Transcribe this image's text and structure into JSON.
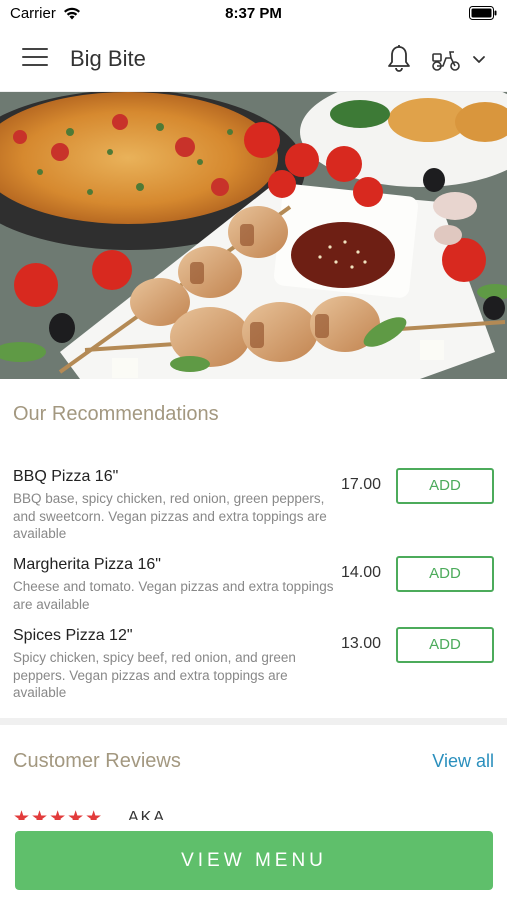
{
  "status_bar": {
    "carrier": "Carrier",
    "time": "8:37 PM"
  },
  "header": {
    "title": "Big Bite",
    "icons": [
      "menu-icon",
      "bell-icon",
      "scooter-icon",
      "chevron-down-icon"
    ]
  },
  "hero": {
    "image_description_icon": "food-photo"
  },
  "recommendations": {
    "title": "Our Recommendations",
    "items": [
      {
        "name": "BBQ Pizza 16\"",
        "description": "BBQ base, spicy chicken, red onion, green peppers, and sweetcorn. Vegan pizzas and extra toppings are available",
        "price": "17.00",
        "add_label": "ADD"
      },
      {
        "name": "Margherita Pizza 16\"",
        "description": "Cheese and tomato. Vegan pizzas and extra toppings are available",
        "price": "14.00",
        "add_label": "ADD"
      },
      {
        "name": "Spices Pizza 12\"",
        "description": "Spicy chicken, spicy beef, red onion, and green peppers. Vegan pizzas and extra toppings are available",
        "price": "13.00",
        "add_label": "ADD"
      }
    ]
  },
  "reviews": {
    "title": "Customer Reviews",
    "view_all_label": "View all",
    "first_review": {
      "stars": "★★★★★",
      "rating": 5,
      "reviewer": "AKA"
    }
  },
  "footer": {
    "view_menu_label": "VIEW MENU"
  },
  "colors": {
    "accent_green": "#5fbf6b",
    "button_green": "#4cab5b",
    "section_title": "#a39880",
    "link_blue": "#2a8fbd",
    "star_red": "#e23b3b"
  }
}
